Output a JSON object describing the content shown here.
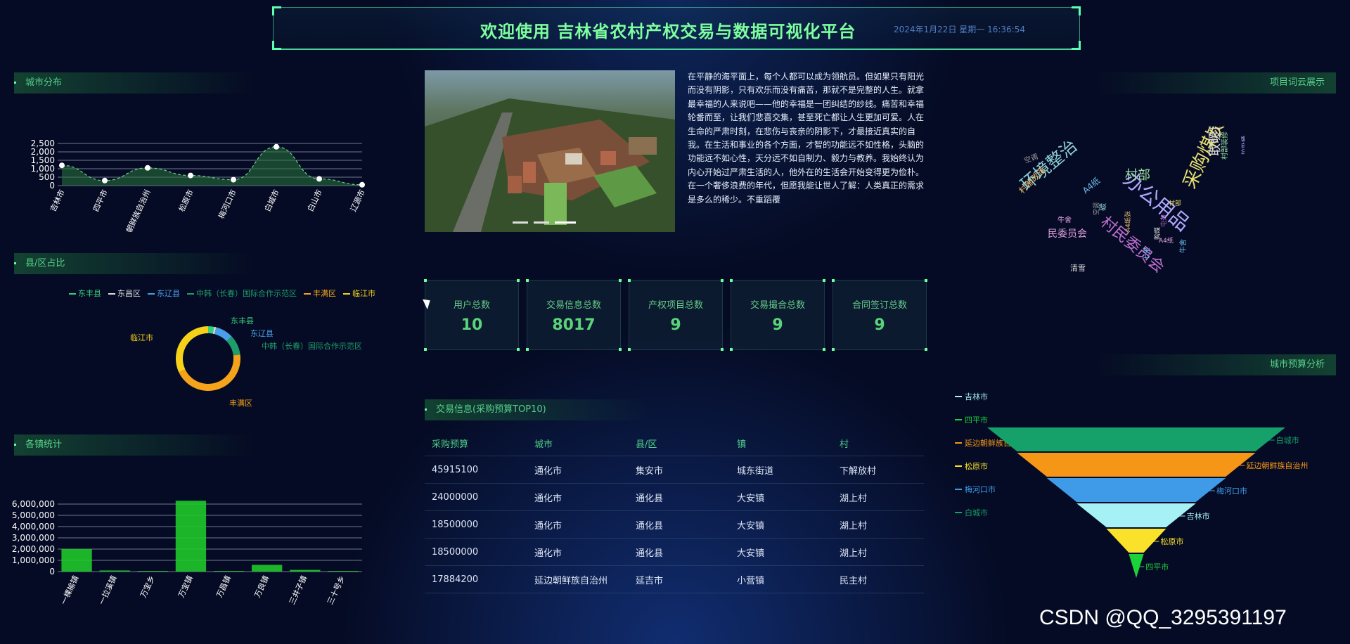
{
  "header": {
    "title": "欢迎使用 吉林省农村产权交易与数据可视化平台",
    "datetime": "2024年1月22日 星期一 16:36:54"
  },
  "panels": {
    "city_dist": "城市分布",
    "county_ratio": "县/区占比",
    "town_stats": "各镇统计",
    "word_cloud": "项目词云展示",
    "city_budget": "城市预算分析",
    "transactions": "交易信息(采购预算TOP10)"
  },
  "article": "在平静的海平面上，每个人都可以成为领航员。但如果只有阳光而没有阴影，只有欢乐而没有痛苦，那就不是完整的人生。就拿最幸福的人来说吧——他的幸福是一团纠结的纱线。痛苦和幸福轮番而至，让我们悲喜交集，甚至死亡都让人生更加可爱。人在生命的严肃时刻，在悲伤与丧亲的阴影下，才最接近真实的自我。在生活和事业的各个方面，才智的功能远不如性格，头脑的功能远不如心性，天分远不如自制力、毅力与教养。我始终认为内心开始过严肃生活的人，他外在的生活会开始变得更为俭朴。在一个奢侈浪费的年代，但愿我能让世人了解：人类真正的需求是多么的稀少。不重蹈覆",
  "stats": [
    {
      "label": "用户总数",
      "value": "10"
    },
    {
      "label": "交易信息总数",
      "value": "8017"
    },
    {
      "label": "产权项目总数",
      "value": "9"
    },
    {
      "label": "交易撮合总数",
      "value": "9"
    },
    {
      "label": "合同签订总数",
      "value": "9"
    }
  ],
  "table": {
    "headers": [
      "采购预算",
      "城市",
      "县/区",
      "镇",
      "村"
    ],
    "rows": [
      [
        "45915100",
        "通化市",
        "集安市",
        "城东街道",
        "下解放村"
      ],
      [
        "24000000",
        "通化市",
        "通化县",
        "大安镇",
        "湖上村"
      ],
      [
        "18500000",
        "通化市",
        "通化县",
        "大安镇",
        "湖上村"
      ],
      [
        "18500000",
        "通化市",
        "通化县",
        "大安镇",
        "湖上村"
      ],
      [
        "17884200",
        "延边朝鲜族自治州",
        "延吉市",
        "小营镇",
        "民主村"
      ]
    ]
  },
  "words": [
    "采购煤炭",
    "办公用品",
    "环境整治",
    "村民委员会",
    "取暖用煤",
    "村部",
    "民委员会",
    "A4纸",
    "村部改造",
    "空调",
    "牛舍",
    "清雪",
    "七里",
    "A4纸张",
    "村部装修",
    "垃圾桶",
    "空调",
    "碳",
    "村部",
    "屯务",
    "购煤",
    "A4纸",
    "牛舍"
  ],
  "watermark": "CSDN @QQ_3295391197",
  "chart_data": [
    {
      "type": "area",
      "title": "城市分布",
      "categories": [
        "吉林市",
        "四平市",
        "朝鲜族自治州",
        "松原市",
        "梅河口市",
        "白城市",
        "白山市",
        "辽源市"
      ],
      "values": [
        1200,
        300,
        1050,
        600,
        350,
        2300,
        400,
        50
      ],
      "yticks": [
        "0",
        "500",
        "1,000",
        "1,500",
        "2,000",
        "2,500"
      ],
      "ylim": [
        0,
        2500
      ]
    },
    {
      "type": "pie",
      "title": "县/区占比",
      "legend": [
        "东丰县",
        "东昌区",
        "东辽县",
        "中韩（长春）国际合作示范区",
        "丰满区",
        "临江市"
      ],
      "labels": [
        "东丰县",
        "东辽县",
        "中韩（长春）国际合作示范区",
        "丰满区",
        "临江市"
      ],
      "values": [
        3,
        1,
        9,
        10,
        45,
        32
      ],
      "colors": [
        "#38d07a",
        "#dddddd",
        "#4aa0e8",
        "#1d9e6a",
        "#f5a31a",
        "#f6d11a"
      ]
    },
    {
      "type": "bar",
      "title": "各镇统计",
      "categories": [
        "一棵榆镇",
        "一拉溪镇",
        "万宝乡",
        "万宝镇",
        "万昌镇",
        "万良镇",
        "三井子镇",
        "三十号乡"
      ],
      "values": [
        2000000,
        100000,
        0,
        6500000,
        0,
        600000,
        150000,
        0
      ],
      "yticks": [
        "0",
        "1,000,000",
        "2,000,000",
        "3,000,000",
        "4,000,000",
        "5,000,000",
        "6,000,000"
      ],
      "ylim": [
        0,
        6000000
      ]
    },
    {
      "type": "funnel",
      "title": "城市预算分析",
      "legend": [
        "吉林市",
        "四平市",
        "延边朝鲜族自治州",
        "松原市",
        "梅河口市",
        "白城市"
      ],
      "order": [
        "白城市",
        "延边朝鲜族自治州",
        "梅河口市",
        "吉林市",
        "松原市",
        "四平市"
      ],
      "values": [
        100,
        80,
        60,
        40,
        20,
        5
      ],
      "colors": [
        "#16a06a",
        "#f59617",
        "#3f9be8",
        "#a5f1f5",
        "#f9e229",
        "#1bd23a"
      ]
    }
  ]
}
